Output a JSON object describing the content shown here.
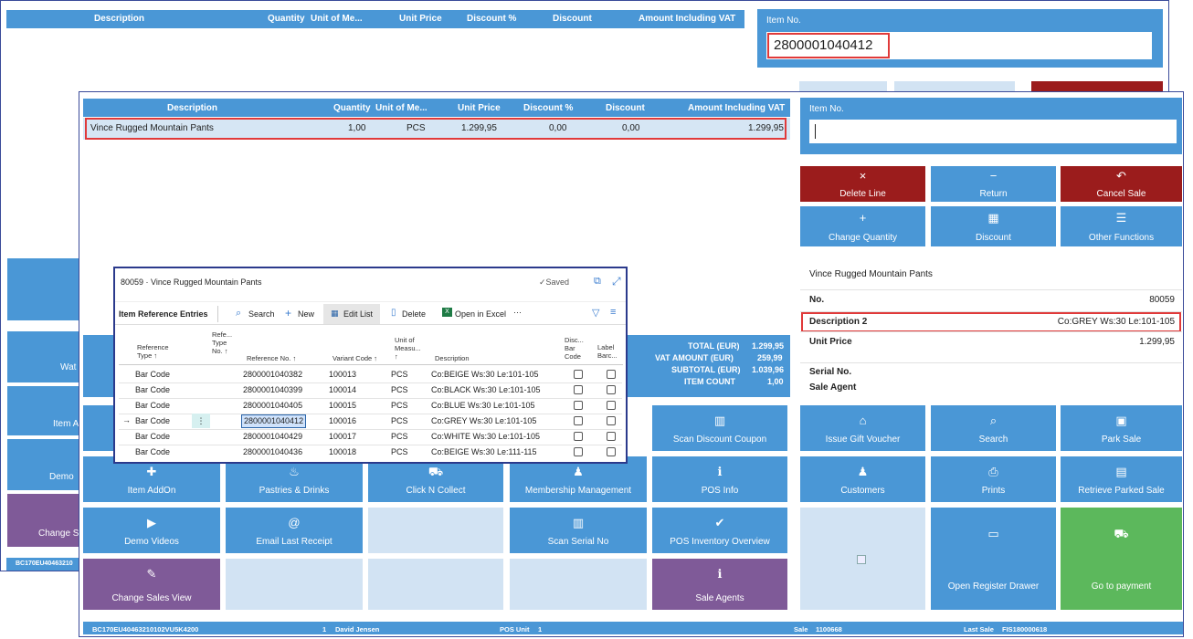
{
  "back_window": {
    "grid_headers": [
      "Description",
      "Quantity",
      "Unit of Me...",
      "Unit Price",
      "Discount %",
      "Discount",
      "Amount Including VAT"
    ],
    "item_no_label": "Item No.",
    "item_no_value": "2800001040412",
    "left_tiles": [
      "Wat",
      "Item A",
      "Demo",
      "Change S"
    ],
    "status_id": "BC170EU40463210"
  },
  "front_window": {
    "grid_headers": [
      "Description",
      "Quantity",
      "Unit of Me...",
      "Unit Price",
      "Discount %",
      "Discount",
      "Amount Including VAT"
    ],
    "sale_line": {
      "description": "Vince Rugged Mountain Pants",
      "quantity": "1,00",
      "uom": "PCS",
      "unit_price": "1.299,95",
      "discount_pct": "0,00",
      "discount": "0,00",
      "amount": "1.299,95"
    },
    "item_no_label": "Item No.",
    "item_no_value": "",
    "action_tiles": [
      {
        "label": "Delete Line",
        "icon": "×",
        "name": "delete-line-button",
        "icon_name": "close-icon"
      },
      {
        "label": "Return",
        "icon": "−",
        "name": "return-button",
        "icon_name": "minus-circle-icon"
      },
      {
        "label": "Cancel Sale",
        "icon": "↶",
        "name": "cancel-sale-button",
        "icon_name": "undo-icon"
      },
      {
        "label": "Change Quantity",
        "icon": "+",
        "name": "change-quantity-button",
        "icon_name": "plus-circle-icon"
      },
      {
        "label": "Discount",
        "icon": "▦",
        "name": "discount-button",
        "icon_name": "calculator-icon"
      },
      {
        "label": "Other Functions",
        "icon": "☰",
        "name": "other-functions-button",
        "icon_name": "menu-icon"
      }
    ],
    "item_info": {
      "title": "Vince Rugged Mountain Pants",
      "no_label": "No.",
      "no_value": "80059",
      "desc2_label": "Description 2",
      "desc2_value": "Co:GREY Ws:30 Le:101-105",
      "unit_price_label": "Unit Price",
      "unit_price_value": "1.299,95"
    },
    "serial_label": "Serial No.",
    "sale_agent_label": "Sale Agent",
    "totals": {
      "total_label": "TOTAL (EUR)",
      "total_value": "1.299,95",
      "vat_label": "VAT AMOUNT (EUR)",
      "vat_value": "259,99",
      "subtotal_label": "SUBTOTAL (EUR)",
      "subtotal_value": "1.039,96",
      "count_label": "ITEM COUNT",
      "count_value": "1,00"
    },
    "grid_tiles": [
      {
        "label": "Scan Discount Coupon",
        "icon": "▥",
        "name": "scan-discount-coupon-button",
        "icon_name": "barcode-icon"
      },
      {
        "label": "Item AddOn",
        "icon": "✚",
        "name": "item-addon-button",
        "icon_name": "addon-icon"
      },
      {
        "label": "Pastries & Drinks",
        "icon": "♨",
        "name": "pastries-drinks-button",
        "icon_name": "cup-icon"
      },
      {
        "label": "Click N Collect",
        "icon": "⛟",
        "name": "click-n-collect-button",
        "icon_name": "cart-icon"
      },
      {
        "label": "Membership Management",
        "icon": "♟",
        "name": "membership-management-button",
        "icon_name": "users-icon"
      },
      {
        "label": "POS Info",
        "icon": "ℹ",
        "name": "pos-info-button",
        "icon_name": "info-icon"
      },
      {
        "label": "Demo Videos",
        "icon": "▶",
        "name": "demo-videos-button",
        "icon_name": "video-icon"
      },
      {
        "label": "Email Last Receipt",
        "icon": "@",
        "name": "email-last-receipt-button",
        "icon_name": "at-icon"
      },
      {
        "label": "Scan Serial No",
        "icon": "▥",
        "name": "scan-serial-no-button",
        "icon_name": "barcode-icon"
      },
      {
        "label": "POS Inventory Overview",
        "icon": "✔",
        "name": "pos-inventory-overview-button",
        "icon_name": "check-icon"
      },
      {
        "label": "Change Sales View",
        "icon": "✎",
        "name": "change-sales-view-button",
        "icon_name": "wand-icon"
      },
      {
        "label": "Sale Agents",
        "icon": "ℹ",
        "name": "sale-agents-button",
        "icon_name": "info-icon"
      }
    ],
    "right_tiles": [
      {
        "label": "Issue Gift Voucher",
        "icon": "⌂",
        "name": "issue-gift-voucher-button",
        "icon_name": "gift-icon"
      },
      {
        "label": "Search",
        "icon": "⌕",
        "name": "search-button",
        "icon_name": "search-icon"
      },
      {
        "label": "Park Sale",
        "icon": "▣",
        "name": "park-sale-button",
        "icon_name": "save-icon"
      },
      {
        "label": "Customers",
        "icon": "♟",
        "name": "customers-button",
        "icon_name": "user-icon"
      },
      {
        "label": "Prints",
        "icon": "⎙",
        "name": "prints-button",
        "icon_name": "printer-icon"
      },
      {
        "label": "Retrieve Parked Sale",
        "icon": "▤",
        "name": "retrieve-parked-sale-button",
        "icon_name": "briefcase-icon"
      },
      {
        "label": "Open Register Drawer",
        "icon": "▭",
        "name": "open-register-drawer-button",
        "icon_name": "drawer-icon"
      },
      {
        "label": "Go to payment",
        "icon": "⛟",
        "name": "go-to-payment-button",
        "icon_name": "cart-icon"
      }
    ],
    "status": {
      "id": "BC170EU40463210102VU5K4200",
      "user_no": "1",
      "user": "David Jensen",
      "pos_unit_label": "POS Unit",
      "pos_unit": "1",
      "sale_label": "Sale",
      "sale": "1100668",
      "last_sale_label": "Last Sale",
      "last_sale": "FIS180000618"
    }
  },
  "dialog": {
    "title": "80059 · Vince Rugged Mountain Pants",
    "saved": "✓Saved",
    "page_name": "Item Reference Entries",
    "actions": {
      "search": "Search",
      "new": "New",
      "edit_list": "Edit List",
      "delete": "Delete",
      "open_excel": "Open in Excel",
      "more": "···"
    },
    "columns": [
      [
        "Reference",
        "Type ↑"
      ],
      [
        "Refe...",
        "Type",
        "No. ↑"
      ],
      [
        "Reference No. ↑"
      ],
      [
        "Variant Code ↑"
      ],
      [
        "Unit of",
        "Measu...",
        "↑"
      ],
      [
        "Description"
      ],
      [
        "Disc...",
        "Bar",
        "Code"
      ],
      [
        "Label",
        "Barc..."
      ]
    ],
    "rows": [
      {
        "type": "Bar Code",
        "ref_no": "2800001040382",
        "variant": "100013",
        "uom": "PCS",
        "desc": "Co:BEIGE Ws:30 Le:101-105"
      },
      {
        "type": "Bar Code",
        "ref_no": "2800001040399",
        "variant": "100014",
        "uom": "PCS",
        "desc": "Co:BLACK Ws:30 Le:101-105"
      },
      {
        "type": "Bar Code",
        "ref_no": "2800001040405",
        "variant": "100015",
        "uom": "PCS",
        "desc": "Co:BLUE Ws:30 Le:101-105"
      },
      {
        "type": "Bar Code",
        "ref_no": "2800001040412",
        "variant": "100016",
        "uom": "PCS",
        "desc": "Co:GREY Ws:30 Le:101-105"
      },
      {
        "type": "Bar Code",
        "ref_no": "2800001040429",
        "variant": "100017",
        "uom": "PCS",
        "desc": "Co:WHITE Ws:30 Le:101-105"
      },
      {
        "type": "Bar Code",
        "ref_no": "2800001040436",
        "variant": "100018",
        "uom": "PCS",
        "desc": "Co:BEIGE Ws:30 Le:111-115"
      }
    ],
    "selected_row_marker": "→",
    "row_menu": "⋮"
  }
}
